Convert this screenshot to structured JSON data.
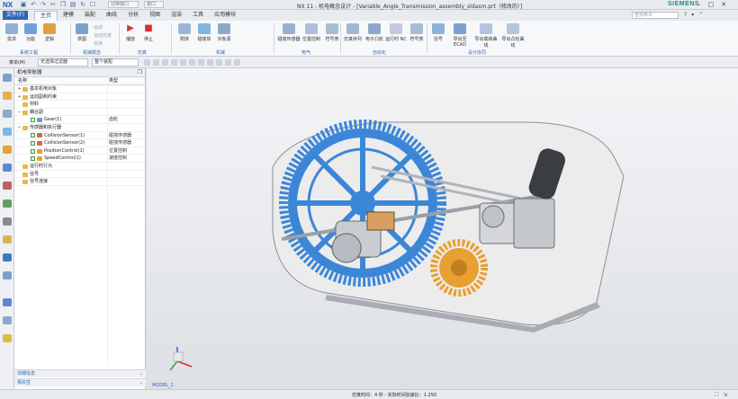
{
  "window": {
    "app_logo": "NX",
    "title": "NX 11 - 机电概念设计 - [Variable_Angle_Transmission_assembly_sldasm.prt（修改的）]",
    "brand": "SIEMENS",
    "qat_field1": "切换窗口",
    "qat_field2": "窗口"
  },
  "menu": {
    "file": "文件(F)",
    "tabs": [
      "主页",
      "建模",
      "装配",
      "曲线",
      "分析",
      "视图",
      "渲染",
      "工具",
      "应用模块"
    ],
    "search_placeholder": "查找命令"
  },
  "ribbon": {
    "buttons": [
      "需求",
      "功能",
      "逻辑",
      "草图",
      "播放",
      "停止",
      "刚体",
      "碰撞体",
      "对象源",
      "碰撞传感器",
      "位置控制",
      "符号表",
      "仿真序列",
      "电子凸轮",
      "运行时 NC",
      "符号表",
      "信号",
      "导出至 ECAD",
      "导出载荷曲线",
      "导出凸轮曲线"
    ],
    "small_items": [
      "运动",
      "运动仿真",
      "变换"
    ],
    "groups": [
      "系统工程",
      "机械概念",
      "仿真",
      "机械",
      "电气",
      "自动化",
      "设计协同"
    ]
  },
  "selection": {
    "menu_label": "菜单(M)",
    "filter_label": "无选择过滤器",
    "scope_label": "整个装配"
  },
  "navigator": {
    "title": "机电导航器",
    "col_name": "名称",
    "col_type": "类型",
    "rows": [
      {
        "label": "基本机电对象",
        "type": ""
      },
      {
        "label": "运动副和约束",
        "type": ""
      },
      {
        "label": "材料",
        "type": ""
      },
      {
        "label": "耦合副",
        "type": ""
      },
      {
        "label": "Gear(1)",
        "type": "齿轮"
      },
      {
        "label": "传感器和执行器",
        "type": ""
      },
      {
        "label": "CollisionSensor(1)",
        "type": "碰撞传感器"
      },
      {
        "label": "CollisionSensor(2)",
        "type": "碰撞传感器"
      },
      {
        "label": "PositionControl(1)",
        "type": "位置控制"
      },
      {
        "label": "SpeedControl(1)",
        "type": "速度控制"
      },
      {
        "label": "运行时行为",
        "type": ""
      },
      {
        "label": "信号",
        "type": ""
      },
      {
        "label": "信号连接",
        "type": ""
      }
    ],
    "footer1": "详细信息",
    "footer2": "相关性"
  },
  "viewport": {
    "model_tag": "MODEL_1"
  },
  "status": {
    "text": "仿真时间：4 秒 - 实际时间加速比：1.250"
  },
  "colors": {
    "accent": "#2f66b8",
    "gear_blue": "#3c86d8",
    "gear_gold": "#e8a030",
    "folder": "#e8b84a"
  }
}
